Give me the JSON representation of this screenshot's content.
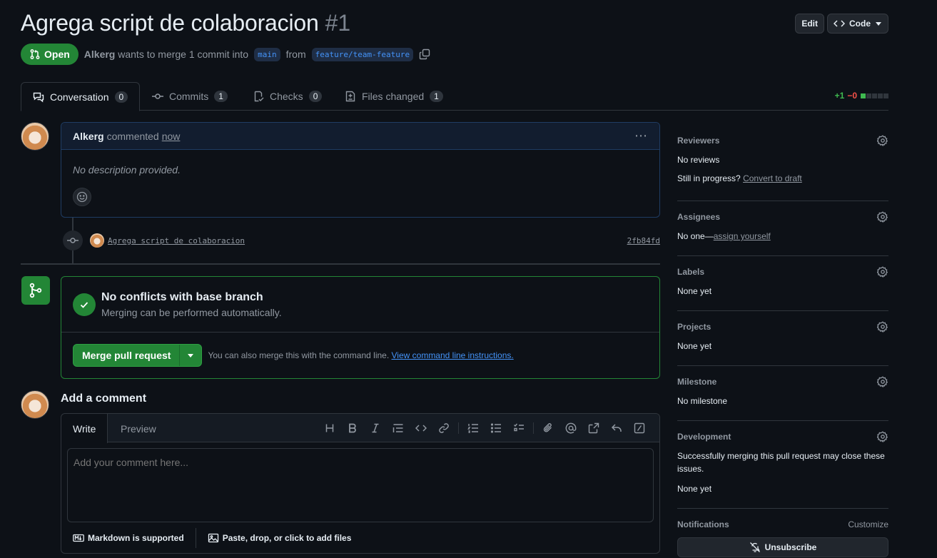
{
  "pr": {
    "title": "Agrega script de colaboracion",
    "number": "#1",
    "state": "Open",
    "author": "Alkerg",
    "merge_text": "wants to merge 1 commit into",
    "base_branch": "main",
    "from_text": "from",
    "head_branch": "feature/team-feature"
  },
  "header_actions": {
    "edit_label": "Edit",
    "code_label": "Code"
  },
  "tabs": [
    {
      "label": "Conversation",
      "count": "0"
    },
    {
      "label": "Commits",
      "count": "1"
    },
    {
      "label": "Checks",
      "count": "0"
    },
    {
      "label": "Files changed",
      "count": "1"
    }
  ],
  "diffstat": {
    "additions": "+1",
    "deletions": "−0",
    "squares": [
      "#3fb950",
      "#30363d",
      "#30363d",
      "#30363d",
      "#30363d"
    ]
  },
  "comment": {
    "author": "Alkerg",
    "action": "commented",
    "time": "now",
    "body": "No description provided."
  },
  "commit": {
    "message": "Agrega script de colaboracion",
    "sha": "2fb84fd"
  },
  "merge": {
    "title": "No conflicts with base branch",
    "subtitle": "Merging can be performed automatically.",
    "button_label": "Merge pull request",
    "hint": "You can also merge this with the command line.",
    "hint_link": "View command line instructions."
  },
  "add_comment": {
    "title": "Add a comment",
    "write_tab": "Write",
    "preview_tab": "Preview",
    "placeholder": "Add your comment here...",
    "markdown_label": "Markdown is supported",
    "files_label": "Paste, drop, or click to add files"
  },
  "sidebar": {
    "reviewers": {
      "title": "Reviewers",
      "value": "No reviews",
      "progress_text": "Still in progress?",
      "progress_link": "Convert to draft"
    },
    "assignees": {
      "title": "Assignees",
      "value": "No one—",
      "link": "assign yourself"
    },
    "labels": {
      "title": "Labels",
      "value": "None yet"
    },
    "projects": {
      "title": "Projects",
      "value": "None yet"
    },
    "milestone": {
      "title": "Milestone",
      "value": "No milestone"
    },
    "development": {
      "title": "Development",
      "desc": "Successfully merging this pull request may close these issues.",
      "value": "None yet"
    },
    "notifications": {
      "title": "Notifications",
      "customize": "Customize",
      "button": "Unsubscribe"
    }
  },
  "colors": {
    "accent_green": "#238636",
    "link_blue": "#4493f8",
    "background": "#0d1117"
  }
}
